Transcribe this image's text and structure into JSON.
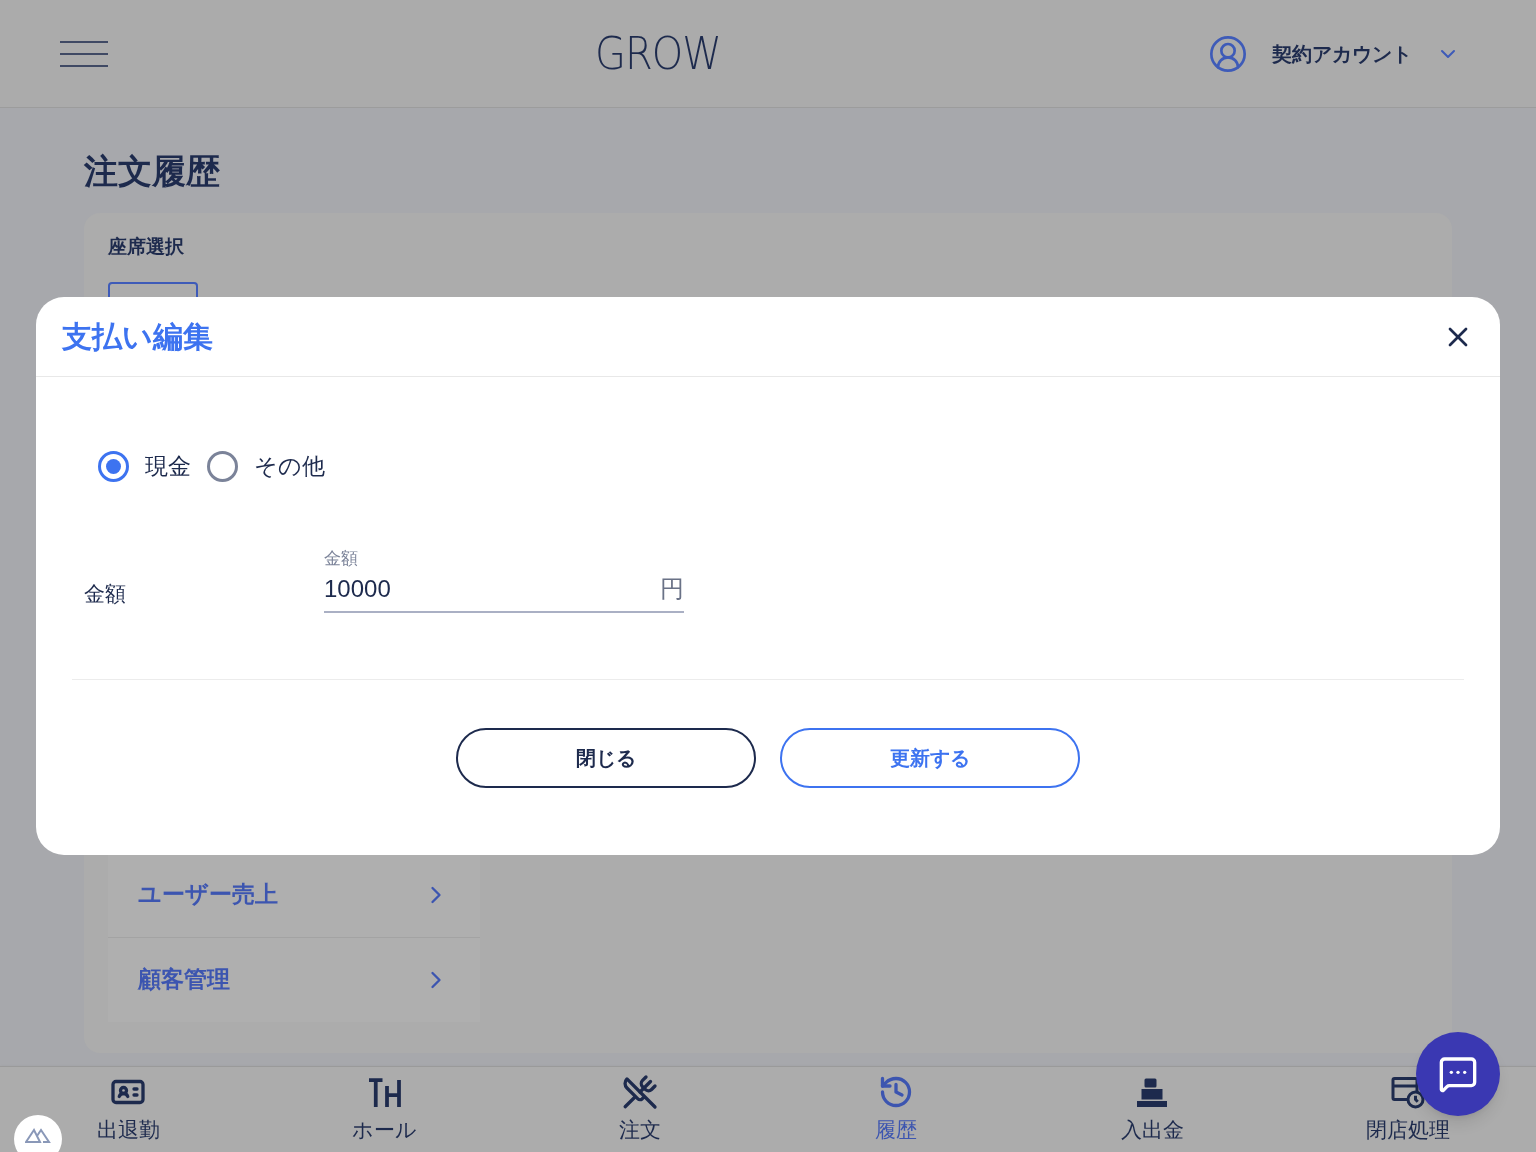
{
  "header": {
    "logo": "GROW",
    "account": "契約アカウント"
  },
  "page": {
    "title": "注文履歴",
    "seat_section": {
      "label": "座席選択"
    },
    "menu": [
      {
        "label": "ユーザー売上"
      },
      {
        "label": "顧客管理"
      }
    ]
  },
  "dialog": {
    "title": "支払い編集",
    "payment_methods": [
      {
        "label": "現金",
        "selected": true
      },
      {
        "label": "その他",
        "selected": false
      }
    ],
    "amount": {
      "label": "金額",
      "field_label": "金額",
      "value": "10000",
      "unit": "円"
    },
    "buttons": [
      {
        "label": "閉じる",
        "kind": "secondary"
      },
      {
        "label": "更新する",
        "kind": "primary"
      }
    ]
  },
  "bottom_nav": [
    {
      "label": "出退勤",
      "kind": "attendance",
      "selected": false
    },
    {
      "label": "ホール",
      "kind": "hall",
      "selected": false
    },
    {
      "label": "注文",
      "kind": "order",
      "selected": false
    },
    {
      "label": "履歴",
      "kind": "history",
      "selected": true
    },
    {
      "label": "入出金",
      "kind": "cash",
      "selected": false
    },
    {
      "label": "閉店処理",
      "kind": "closing",
      "selected": false
    }
  ]
}
